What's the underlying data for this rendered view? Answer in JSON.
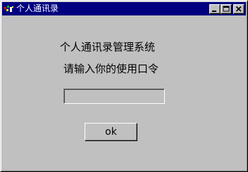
{
  "window": {
    "title": "个人通讯录",
    "titlebar_color": "#000080",
    "background_color": "#c0c0c0",
    "icons": {
      "app": "app-icon",
      "minimize": "minimize-icon",
      "maximize": "maximize-icon",
      "close": "close-icon"
    }
  },
  "content": {
    "heading": "个人通讯录管理系统",
    "prompt": "请输入你的使用口令",
    "password_value": "",
    "ok_label": "ok"
  }
}
